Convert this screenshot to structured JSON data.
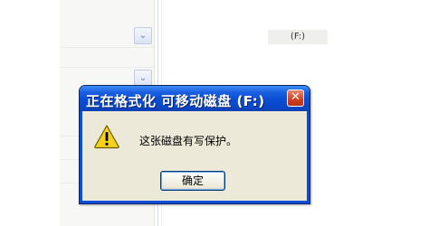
{
  "background": {
    "drive_label": "(F:)"
  },
  "dialog": {
    "title": "正在格式化 可移动磁盘 (F:)",
    "close_glyph": "✕",
    "message": "这张磁盘有写保护。",
    "icon": "warning-icon",
    "ok_label": "确定"
  },
  "colors": {
    "titlebar": "#0a4dd6",
    "dialog_body": "#ece9d8",
    "close_button": "#d1411e",
    "warning_fill": "#f5d21b"
  }
}
